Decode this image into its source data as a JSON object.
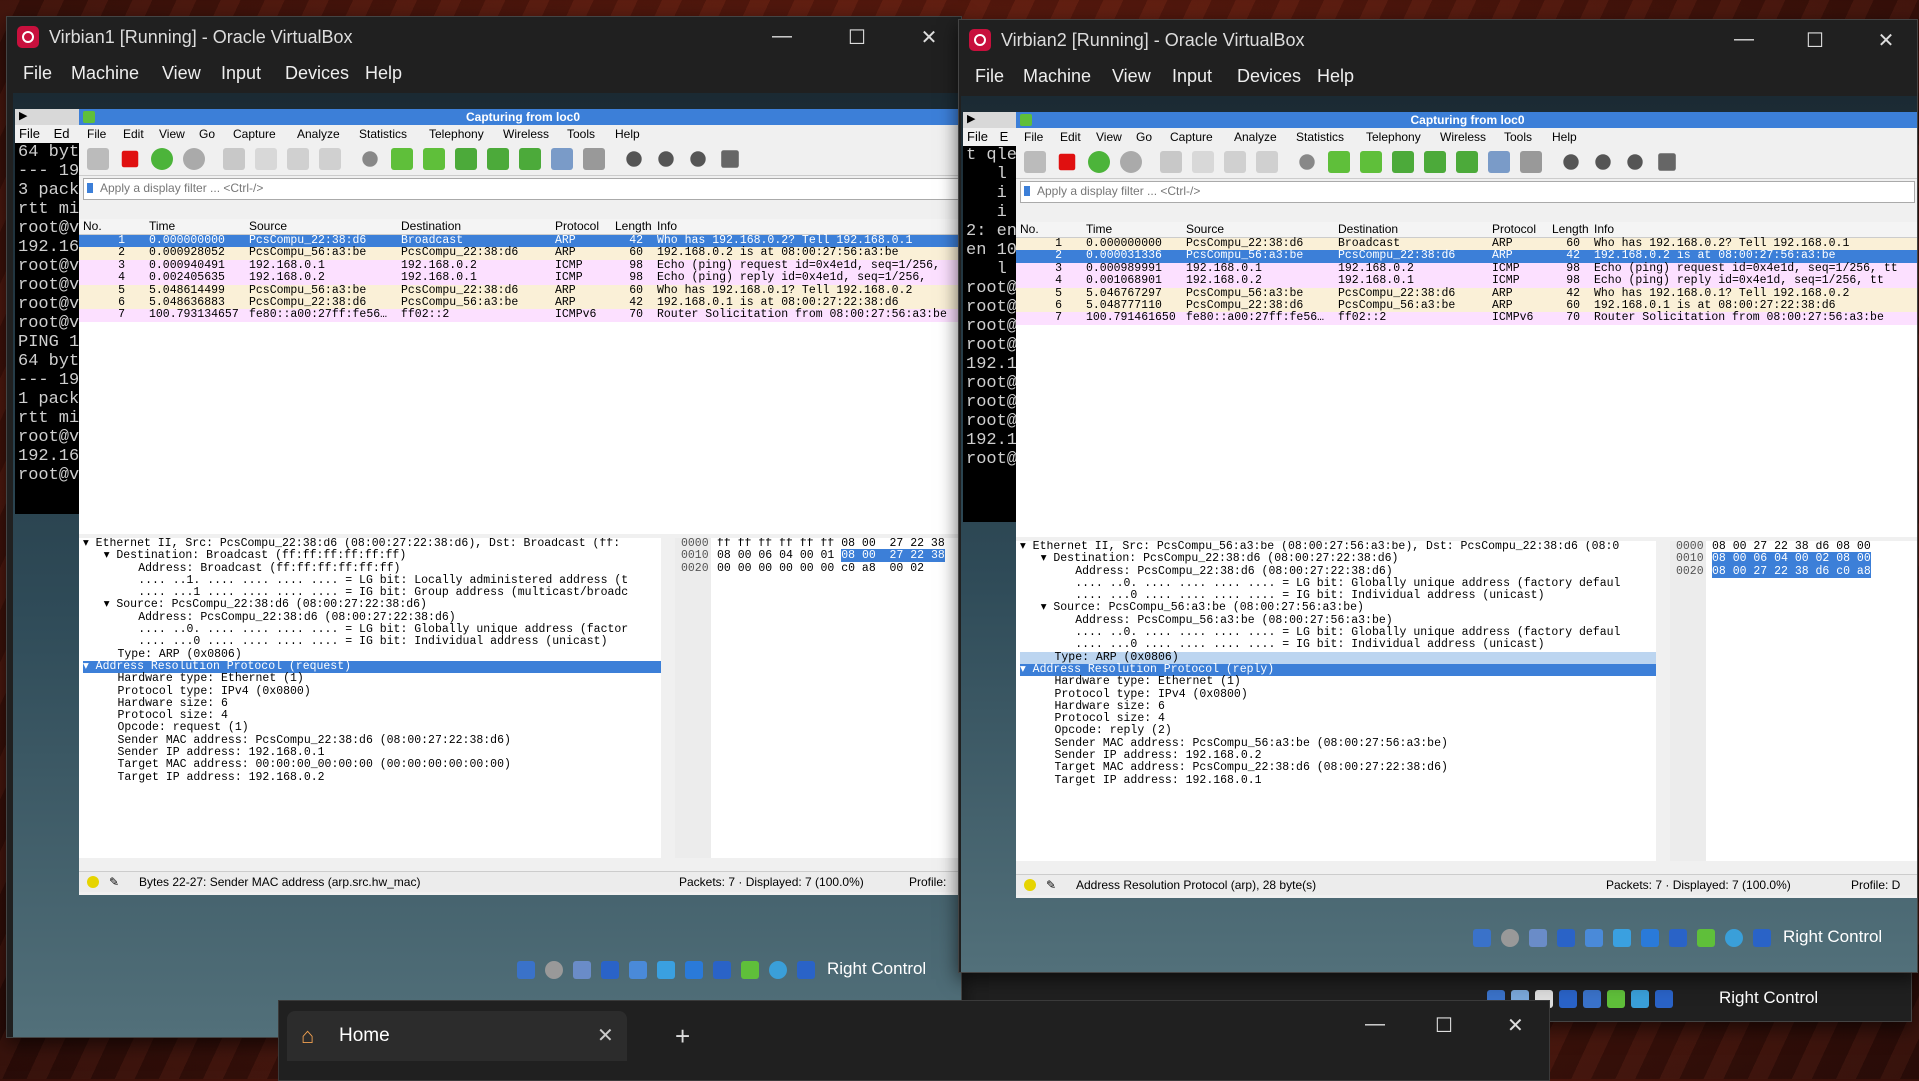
{
  "win1": {
    "title": "Virbian1 [Running] - Oracle VirtualBox",
    "menu": [
      "File",
      "Machine",
      "View",
      "Input",
      "Devices",
      "Help"
    ],
    "terminal": {
      "menu": [
        "File",
        "Ed"
      ],
      "lines": [
        "64 byt",
        "",
        "--- 19",
        "3 pack",
        "rtt mi",
        "root@v",
        "192.16",
        "root@v",
        "root@v",
        "root@v",
        "root@v",
        "PING 1",
        "64 byt",
        "",
        "--- 19",
        "1 pack",
        "rtt mi",
        "root@v",
        "192.16",
        "root@v"
      ]
    },
    "ws": {
      "caption": "Capturing from loc0",
      "menu": [
        "File",
        "Edit",
        "View",
        "Go",
        "Capture",
        "Analyze",
        "Statistics",
        "Telephony",
        "Wireless",
        "Tools",
        "Help"
      ],
      "filter_placeholder": "Apply a display filter ... <Ctrl-/>",
      "headers": [
        "No.",
        "Time",
        "Source",
        "Destination",
        "Protocol",
        "Length",
        "Info"
      ],
      "packets": [
        {
          "no": "1",
          "time": "0.000000000",
          "src": "PcsCompu_22:38:d6",
          "dst": "Broadcast",
          "proto": "ARP",
          "len": "42",
          "info": "Who has 192.168.0.2? Tell 192.168.0.1"
        },
        {
          "no": "2",
          "time": "0.000928052",
          "src": "PcsCompu_56:a3:be",
          "dst": "PcsCompu_22:38:d6",
          "proto": "ARP",
          "len": "60",
          "info": "192.168.0.2 is at 08:00:27:56:a3:be"
        },
        {
          "no": "3",
          "time": "0.000940491",
          "src": "192.168.0.1",
          "dst": "192.168.0.2",
          "proto": "ICMP",
          "len": "98",
          "info": "Echo (ping) request  id=0x4e1d, seq=1/256,"
        },
        {
          "no": "4",
          "time": "0.002405635",
          "src": "192.168.0.2",
          "dst": "192.168.0.1",
          "proto": "ICMP",
          "len": "98",
          "info": "Echo (ping) reply    id=0x4e1d, seq=1/256,"
        },
        {
          "no": "5",
          "time": "5.048614499",
          "src": "PcsCompu_56:a3:be",
          "dst": "PcsCompu_22:38:d6",
          "proto": "ARP",
          "len": "60",
          "info": "Who has 192.168.0.1? Tell 192.168.0.2"
        },
        {
          "no": "6",
          "time": "5.048636883",
          "src": "PcsCompu_22:38:d6",
          "dst": "PcsCompu_56:a3:be",
          "proto": "ARP",
          "len": "42",
          "info": "192.168.0.1 is at 08:00:27:22:38:d6"
        },
        {
          "no": "7",
          "time": "100.793134657",
          "src": "fe80::a00:27ff:fe56…",
          "dst": "ff02::2",
          "proto": "ICMPv6",
          "len": "70",
          "info": "Router Solicitation from 08:00:27:56:a3:be"
        }
      ],
      "details": [
        "▾ Ethernet II, Src: PcsCompu_22:38:d6 (08:00:27:22:38:d6), Dst: Broadcast (ff:",
        "   ▾ Destination: Broadcast (ff:ff:ff:ff:ff:ff)",
        "        Address: Broadcast (ff:ff:ff:ff:ff:ff)",
        "        .... ..1. .... .... .... .... = LG bit: Locally administered address (t",
        "        .... ...1 .... .... .... .... = IG bit: Group address (multicast/broadc",
        "   ▾ Source: PcsCompu_22:38:d6 (08:00:27:22:38:d6)",
        "        Address: PcsCompu_22:38:d6 (08:00:27:22:38:d6)",
        "        .... ..0. .... .... .... .... = LG bit: Globally unique address (factor",
        "        .... ...0 .... .... .... .... = IG bit: Individual address (unicast)",
        "     Type: ARP (0x0806)",
        "▾ Address Resolution Protocol (request)",
        "     Hardware type: Ethernet (1)",
        "     Protocol type: IPv4 (0x0800)",
        "     Hardware size: 6",
        "     Protocol size: 4",
        "     Opcode: request (1)",
        "     Sender MAC address: PcsCompu_22:38:d6 (08:00:27:22:38:d6)",
        "     Sender IP address: 192.168.0.1",
        "     Target MAC address: 00:00:00_00:00:00 (00:00:00:00:00:00)",
        "     Target IP address: 192.168.0.2"
      ],
      "hex": [
        {
          "off": "0000",
          "a": "ff ff ff ff ff ff 08 00  27 22 38",
          "sel": ""
        },
        {
          "off": "0010",
          "a": "08 00 06 04 00 01 ",
          "sel": "08 00  27 22 38"
        },
        {
          "off": "0020",
          "a": "00 00 00 00 00 00 c0 a8  00 02",
          "sel": ""
        }
      ],
      "status_left": "Bytes 22-27: Sender MAC address (arp.src.hw_mac)",
      "status_mid": "Packets: 7 · Displayed: 7 (100.0%)",
      "status_right": "Profile:"
    },
    "host_key": "Right Control"
  },
  "win2": {
    "title": "Virbian2 [Running] - Oracle VirtualBox",
    "menu": [
      "File",
      "Machine",
      "View",
      "Input",
      "Devices",
      "Help"
    ],
    "terminal": {
      "menu": [
        "File",
        "E"
      ],
      "lines": [
        "t qle",
        "   l",
        "   i",
        "",
        "   i",
        "",
        "2: en",
        "en 10",
        "   l",
        "root@",
        "root@",
        "root@",
        "root@",
        "192.1",
        "root@",
        "root@",
        "root@",
        "192.1",
        "root@"
      ]
    },
    "ws": {
      "caption": "Capturing from loc0",
      "menu": [
        "File",
        "Edit",
        "View",
        "Go",
        "Capture",
        "Analyze",
        "Statistics",
        "Telephony",
        "Wireless",
        "Tools",
        "Help"
      ],
      "filter_placeholder": "Apply a display filter ... <Ctrl-/>",
      "headers": [
        "No.",
        "Time",
        "Source",
        "Destination",
        "Protocol",
        "Length",
        "Info"
      ],
      "packets": [
        {
          "no": "1",
          "time": "0.000000000",
          "src": "PcsCompu_22:38:d6",
          "dst": "Broadcast",
          "proto": "ARP",
          "len": "60",
          "info": "Who has 192.168.0.2? Tell 192.168.0.1"
        },
        {
          "no": "2",
          "time": "0.000031336",
          "src": "PcsCompu_56:a3:be",
          "dst": "PcsCompu_22:38:d6",
          "proto": "ARP",
          "len": "42",
          "info": "192.168.0.2 is at 08:00:27:56:a3:be"
        },
        {
          "no": "3",
          "time": "0.000989991",
          "src": "192.168.0.1",
          "dst": "192.168.0.2",
          "proto": "ICMP",
          "len": "98",
          "info": "Echo (ping) request  id=0x4e1d, seq=1/256, tt"
        },
        {
          "no": "4",
          "time": "0.001068901",
          "src": "192.168.0.2",
          "dst": "192.168.0.1",
          "proto": "ICMP",
          "len": "98",
          "info": "Echo (ping) reply    id=0x4e1d, seq=1/256, tt"
        },
        {
          "no": "5",
          "time": "5.046767297",
          "src": "PcsCompu_56:a3:be",
          "dst": "PcsCompu_22:38:d6",
          "proto": "ARP",
          "len": "42",
          "info": "Who has 192.168.0.1? Tell 192.168.0.2"
        },
        {
          "no": "6",
          "time": "5.048777110",
          "src": "PcsCompu_22:38:d6",
          "dst": "PcsCompu_56:a3:be",
          "proto": "ARP",
          "len": "60",
          "info": "192.168.0.1 is at 08:00:27:22:38:d6"
        },
        {
          "no": "7",
          "time": "100.791461650",
          "src": "fe80::a00:27ff:fe56…",
          "dst": "ff02::2",
          "proto": "ICMPv6",
          "len": "70",
          "info": "Router Solicitation from 08:00:27:56:a3:be"
        }
      ],
      "details": [
        "▾ Ethernet II, Src: PcsCompu_56:a3:be (08:00:27:56:a3:be), Dst: PcsCompu_22:38:d6 (08:0",
        "   ▾ Destination: PcsCompu_22:38:d6 (08:00:27:22:38:d6)",
        "        Address: PcsCompu_22:38:d6 (08:00:27:22:38:d6)",
        "        .... ..0. .... .... .... .... = LG bit: Globally unique address (factory defaul",
        "        .... ...0 .... .... .... .... = IG bit: Individual address (unicast)",
        "   ▾ Source: PcsCompu_56:a3:be (08:00:27:56:a3:be)",
        "        Address: PcsCompu_56:a3:be (08:00:27:56:a3:be)",
        "        .... ..0. .... .... .... .... = LG bit: Globally unique address (factory defaul",
        "        .... ...0 .... .... .... .... = IG bit: Individual address (unicast)",
        "     Type: ARP (0x0806)",
        "▾ Address Resolution Protocol (reply)",
        "     Hardware type: Ethernet (1)",
        "     Protocol type: IPv4 (0x0800)",
        "     Hardware size: 6",
        "     Protocol size: 4",
        "     Opcode: reply (2)",
        "     Sender MAC address: PcsCompu_56:a3:be (08:00:27:56:a3:be)",
        "     Sender IP address: 192.168.0.2",
        "     Target MAC address: PcsCompu_22:38:d6 (08:00:27:22:38:d6)",
        "     Target IP address: 192.168.0.1"
      ],
      "hex": [
        {
          "off": "0000",
          "a": "08 00 27 22 38 d6 08 00",
          "sel": ""
        },
        {
          "off": "0010",
          "a": "",
          "sel": "08 00 06 04 00 02 08 00"
        },
        {
          "off": "0020",
          "a": "",
          "sel": "08 00 27 22 38 d6 c0 a8"
        }
      ],
      "status_left": "Address Resolution Protocol (arp), 28 byte(s)",
      "status_mid": "Packets: 7 · Displayed: 7 (100.0%)",
      "status_right": "Profile: D"
    },
    "host_key": "Right Control"
  },
  "underlying_host_key": "Right Control",
  "home_tab": {
    "label": "Home"
  },
  "colors": {
    "arp": "#faf0d7",
    "icmp": "#fce0ff",
    "icmpv6": "#fce0ff",
    "selected": "#3c7fd8"
  }
}
